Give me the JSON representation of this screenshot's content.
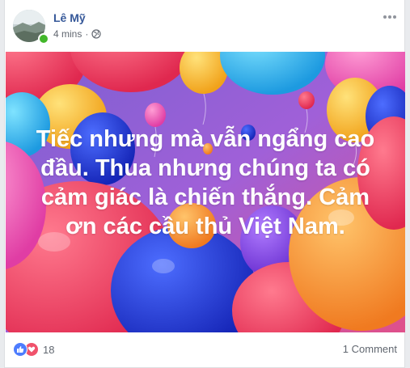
{
  "post": {
    "author": "Lê Mỹ",
    "timestamp": "4 mins",
    "separator": "·",
    "privacy_icon": "globe-icon",
    "text": "Tiếc nhưng mà vẫn ngẩng cao\nđầu. Thua nhưng chúng ta có\ncảm giác là chiến thắng. Cảm\nơn các cầu thủ Việt Nam.",
    "reaction_icons": [
      "like-icon",
      "love-icon"
    ],
    "reaction_count": "18",
    "comments": "1 Comment",
    "colors": {
      "name": "#365899",
      "meta": "#616770",
      "like": "#4d7cfe",
      "love": "#f0526b",
      "background_start": "#7b5fd1",
      "background_end": "#e0508a"
    }
  }
}
